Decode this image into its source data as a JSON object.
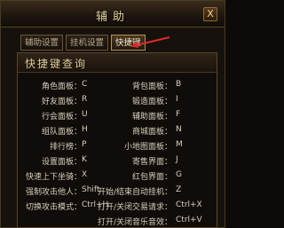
{
  "window": {
    "title": "辅助",
    "close_label": "X"
  },
  "tabs": [
    {
      "label": "辅助设置"
    },
    {
      "label": "挂机设置"
    },
    {
      "label": "快捷键"
    }
  ],
  "panel": {
    "title": "快捷键查询"
  },
  "rows": [
    {
      "left_label": "角色面板：",
      "left_key": "C",
      "right_label": "背包面板：",
      "right_key": "B"
    },
    {
      "left_label": "好友面板：",
      "left_key": "R",
      "right_label": "锻造面板：",
      "right_key": "I"
    },
    {
      "left_label": "行会面板：",
      "left_key": "U",
      "right_label": "辅助面板：",
      "right_key": "F"
    },
    {
      "left_label": "组队面板：",
      "left_key": "H",
      "right_label": "商城面板：",
      "right_key": "N"
    },
    {
      "left_label": "排行榜：",
      "left_key": "P",
      "right_label": "小地图面板：",
      "right_key": "M"
    },
    {
      "left_label": "设置面板：",
      "left_key": "K",
      "right_label": "寄售界面：",
      "right_key": "J"
    },
    {
      "left_label": "快速上下坐骑：",
      "left_key": "X",
      "right_label": "红包界面：",
      "right_key": "G"
    },
    {
      "left_label": "强制攻击他人：",
      "left_key": "Shift",
      "right_label": "开始/结束自动挂机：",
      "right_key": "Z"
    },
    {
      "left_label": "切换攻击模式：",
      "left_key": "Ctrl+H",
      "right_label": "打开/关闭交易请求：",
      "right_key": "Ctrl+X"
    },
    {
      "left_label": "",
      "left_key": "",
      "right_label": "打开/关闭音乐音效：",
      "right_key": "Ctrl+V"
    }
  ]
}
